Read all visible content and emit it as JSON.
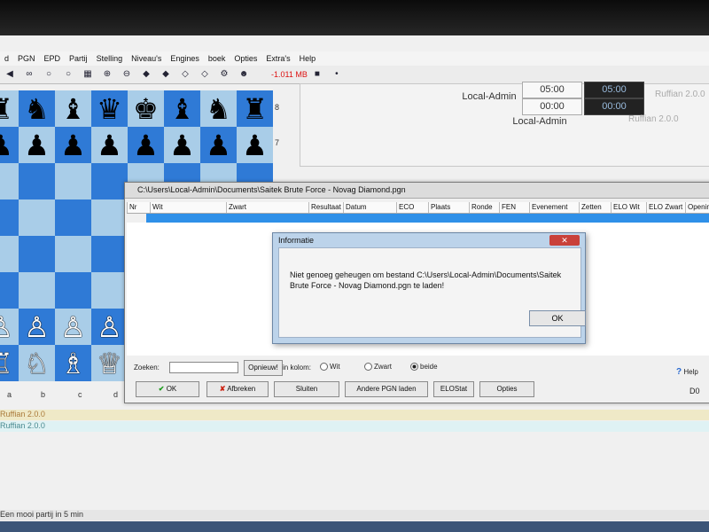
{
  "menu": [
    "d",
    "PGN",
    "EPD",
    "Partij",
    "Stelling",
    "Niveau's",
    "Engines",
    "boek",
    "Opties",
    "Extra's",
    "Help"
  ],
  "toolbar": {
    "memory": "-1.011 MB"
  },
  "board": {
    "ranks_visible": [
      "8",
      "7"
    ],
    "files_visible": [
      "a",
      "b",
      "c",
      "d"
    ],
    "rows": [
      [
        "♜",
        "♞",
        "♝",
        "♛",
        "♚",
        "♝",
        "♞",
        "♜"
      ],
      [
        "♟",
        "♟",
        "♟",
        "♟",
        "♟",
        "♟",
        "♟",
        "♟"
      ],
      [
        "",
        "",
        "",
        "",
        "",
        "",
        "",
        ""
      ],
      [
        "",
        "",
        "",
        "",
        "",
        "",
        "",
        ""
      ],
      [
        "",
        "",
        "",
        "",
        "",
        "",
        "",
        ""
      ],
      [
        "",
        "",
        "",
        "",
        "",
        "",
        "",
        ""
      ],
      [
        "♙",
        "♙",
        "♙",
        "♙",
        "",
        "",
        "",
        ""
      ],
      [
        "♖",
        "♘",
        "♗",
        "♕",
        "",
        "",
        "",
        ""
      ]
    ],
    "colors": {
      "light": "#a9cde8",
      "dark": "#2f7ad6"
    }
  },
  "clock": {
    "player": "Local-Admin",
    "time_white_1": "05:00",
    "time_white_2": "00:00",
    "time_black_1": "05:00",
    "time_black_2": "00:00",
    "player_label": "Local-Admin",
    "engine_label": "Ruffian 2.0.0",
    "engine_name": "Ruffian 2.0.0"
  },
  "pgn_window": {
    "title": "C:\\Users\\Local-Admin\\Documents\\Saitek Brute Force - Novag Diamond.pgn",
    "columns": [
      "Nr",
      "Wit",
      "Zwart",
      "Resultaat",
      "Datum",
      "ECO",
      "Plaats",
      "Ronde",
      "FEN",
      "Evenement",
      "Zetten",
      "ELO Wit",
      "ELO Zwart",
      "Opening"
    ],
    "search_label": "Zoeken:",
    "search_value": "",
    "again_button": "Opnieuw!",
    "column_label": "in kolom:",
    "radio_white": "Wit",
    "radio_black": "Zwart",
    "radio_both": "beide",
    "help_label": "Help",
    "buttons": {
      "ok": "OK",
      "cancel": "Afbreken",
      "close": "Sluiten",
      "other": "Andere PGN laden",
      "elostat": "ELOStat",
      "options": "Opties"
    }
  },
  "dialog": {
    "title": "Informatie",
    "message": "Niet genoeg geheugen om bestand C:\\Users\\Local-Admin\\Documents\\Saitek Brute Force - Novag Diamond.pgn te laden!",
    "ok": "OK"
  },
  "engine_lines": [
    "Ruffian 2.0.0",
    "Ruffian 2.0.0"
  ],
  "right_status": "D0",
  "status_bar": "Een mooi partij in 5 min"
}
